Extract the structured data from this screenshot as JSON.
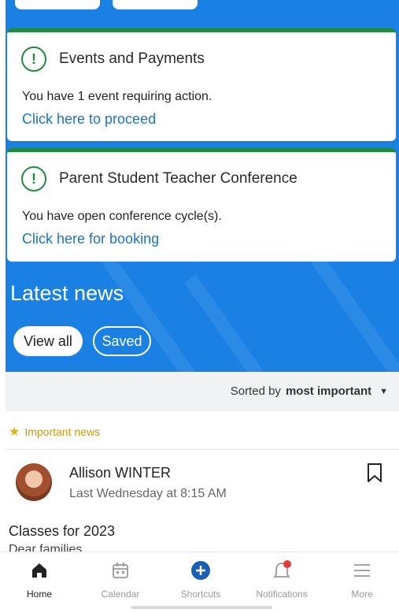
{
  "cards": [
    {
      "title": "Events and Payments",
      "message": "You have 1 event requiring action.",
      "link": "Click here to proceed"
    },
    {
      "title": "Parent Student Teacher Conference",
      "message": "You have open conference cycle(s).",
      "link": "Click here for booking"
    }
  ],
  "news": {
    "heading": "Latest news",
    "view_all": "View all",
    "saved": "Saved",
    "sort_prefix": "Sorted by",
    "sort_value": "most important",
    "important_label": "Important news",
    "post": {
      "author": "Allison WINTER",
      "time": "Last Wednesday at 8:15 AM",
      "title": "Classes for 2023",
      "snippet": "Dear families,"
    }
  },
  "tabs": [
    {
      "label": "Home",
      "icon": "home-icon",
      "active": true
    },
    {
      "label": "Calendar",
      "icon": "calendar-icon",
      "active": false
    },
    {
      "label": "Shortcuts",
      "icon": "plus-icon",
      "active": false
    },
    {
      "label": "Notifications",
      "icon": "bell-icon",
      "active": false
    },
    {
      "label": "More",
      "icon": "menu-icon",
      "active": false
    }
  ],
  "colors": {
    "accent": "#1a80e3",
    "success": "#1f8b3f",
    "link": "#1a73c8",
    "badge": "#e53935",
    "important": "#c69a12"
  }
}
